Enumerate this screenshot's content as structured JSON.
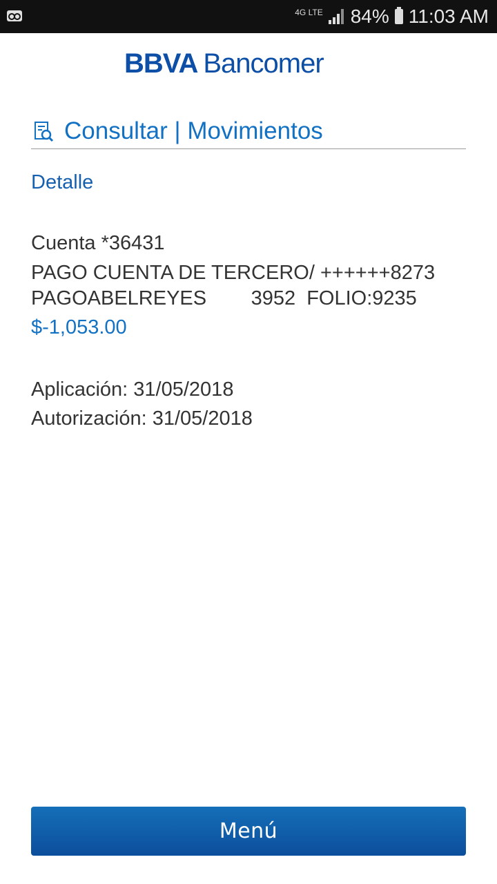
{
  "status_bar": {
    "network": "4G LTE",
    "battery": "84%",
    "time": "11:03 AM"
  },
  "app": {
    "brand_bold": "BBVA",
    "brand_light": "Bancomer"
  },
  "header": {
    "title": "Consultar | Movimientos",
    "icon": "search-document-icon"
  },
  "detail": {
    "label": "Detalle",
    "account": "Cuenta *36431",
    "description_line1": "PAGO CUENTA DE TERCERO/ ++++++8273",
    "description_line2": "PAGOABELREYES        3952  FOLIO:9235",
    "amount": "$-1,053.00",
    "application": "Aplicación: 31/05/2018",
    "authorization": "Autorización: 31/05/2018"
  },
  "footer": {
    "menu_label": "Menú"
  },
  "colors": {
    "brand_blue": "#0d4ea6",
    "accent_blue": "#1271c3"
  }
}
